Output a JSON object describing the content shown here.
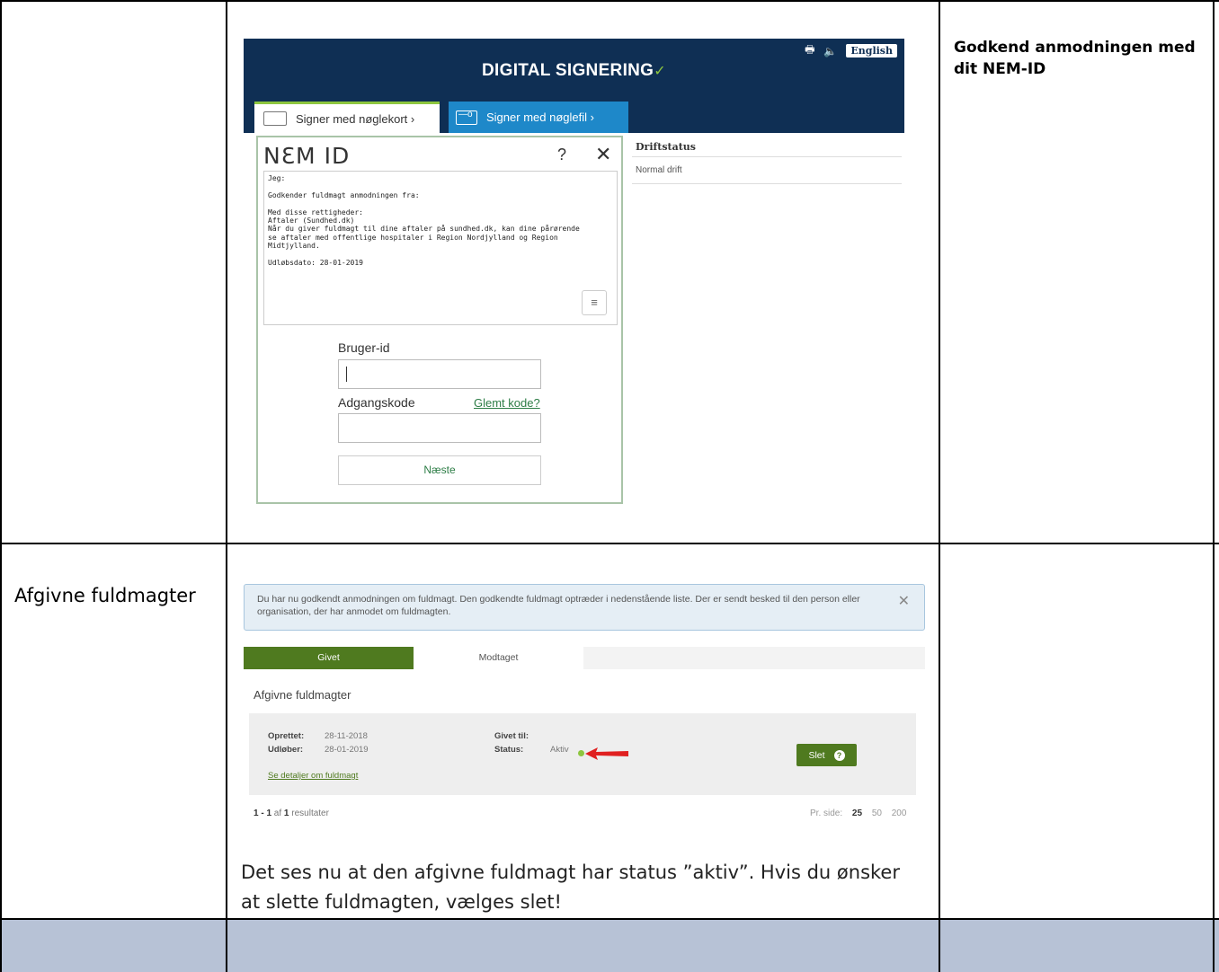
{
  "cells": {
    "row1_right_title": "Godkend anmodningen med dit NEM-ID",
    "row2_left_label": "Afgivne fuldmagter",
    "row2_description": "Det ses nu at den afgivne fuldmagt har status ”aktiv”. Hvis du ønsker at slette fuldmagten, vælges slet!"
  },
  "signing": {
    "title": "DIGITAL SIGNERING",
    "language_button": "English",
    "tab_keycard": "Signer med nøglekort ›",
    "tab_keyfile": "Signer med nøglefil ›"
  },
  "nemid": {
    "logo": "NƐM ID",
    "help": "?",
    "close": "✕",
    "message_lines": [
      "Jeg:",
      "",
      "Godkender fuldmagt anmodningen fra:",
      "",
      "Med disse rettigheder:",
      "Aftaler (Sundhed.dk)",
      "Når du giver fuldmagt til dine aftaler på sundhed.dk, kan dine pårørende",
      "se aftaler med offentlige hospitaler i Region Nordjylland og Region",
      "Midtjylland.",
      "",
      "Udløbsdato: 28-01-2019"
    ],
    "user_id_label": "Bruger-id",
    "user_id_value": "",
    "password_label": "Adgangskode",
    "forgot_link": "Glemt kode?",
    "password_value": "",
    "next_button": "Næste"
  },
  "drift": {
    "title": "Driftstatus",
    "status": "Normal drift"
  },
  "alert": {
    "text": "Du har nu godkendt anmodningen om fuldmagt. Den godkendte fuldmagt optræder i nedenstående liste. Der er sendt besked til den person eller organisation, der har anmodet om fuldmagten.",
    "close": "✕"
  },
  "tabs": {
    "given": "Givet",
    "received": "Modtaget"
  },
  "list": {
    "title": "Afgivne fuldmagter",
    "item": {
      "created_label": "Oprettet:",
      "created_value": "28-11-2018",
      "expires_label": "Udløber:",
      "expires_value": "28-01-2019",
      "given_to_label": "Givet til:",
      "given_to_value": "",
      "status_label": "Status:",
      "status_value": "Aktiv",
      "details_link": "Se detaljer om fuldmagt",
      "delete_button": "Slet"
    },
    "results_range": "1 - 1",
    "results_of": " af ",
    "results_total": "1",
    "results_suffix": " resultater",
    "per_page_label": "Pr. side:",
    "per_page_options": [
      "25",
      "50",
      "200"
    ]
  },
  "colors": {
    "signing_header": "#0f2f54",
    "signing_accent": "#8dc63f",
    "keyfile_tab": "#1e88c9",
    "given_tab": "#4f7a1f",
    "footer_row": "#b7c2d6",
    "arrow": "#e02020"
  },
  "icons": {
    "print": "print-icon",
    "sound": "speaker-icon",
    "keycard": "keycard-icon",
    "keyfile": "keyfile-icon",
    "menu": "menu-icon",
    "help": "question-icon"
  }
}
